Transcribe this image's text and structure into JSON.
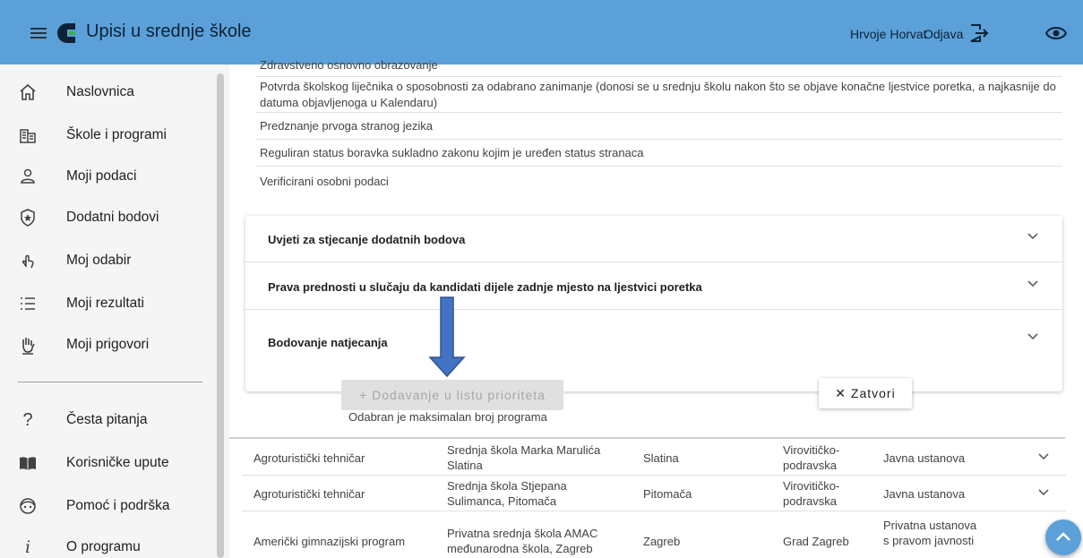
{
  "header": {
    "app_title": "Upisi u srednje škole",
    "user_name": "Hrvoje Horvat",
    "logout_label": "Odjava",
    "bar_color": "#5ba0d9"
  },
  "sidebar": {
    "items": [
      {
        "label": "Naslovnica",
        "icon": "home-icon"
      },
      {
        "label": "Škole i programi",
        "icon": "building-icon"
      },
      {
        "label": "Moji podaci",
        "icon": "person-icon"
      },
      {
        "label": "Dodatni bodovi",
        "icon": "star-shield-icon"
      },
      {
        "label": "Moj odabir",
        "icon": "tap-hand-icon"
      },
      {
        "label": "Moji rezultati",
        "icon": "list-icon"
      },
      {
        "label": "Moji prigovori",
        "icon": "raised-hand-icon"
      }
    ],
    "secondary": [
      {
        "label": "Česta pitanja",
        "icon": "question-icon"
      },
      {
        "label": "Korisničke upute",
        "icon": "book-icon"
      },
      {
        "label": "Pomoć i podrška",
        "icon": "support-icon"
      },
      {
        "label": "O programu",
        "icon": "info-icon"
      }
    ]
  },
  "requirements": [
    "Zdravstveno osnovno obrazovanje",
    "Potvrda školskog liječnika o sposobnosti za odabrano zanimanje (donosi se u srednju školu nakon što se objave konačne ljestvice poretka, a najkasnije do datuma objavljenoga u Kalendaru)",
    "Predznanje prvoga stranog jezika",
    "Reguliran status boravka sukladno zakonu kojim je uređen status stranaca",
    "Verificirani osobni podaci"
  ],
  "accordion": [
    {
      "label": "Uvjeti za stjecanje dodatnih bodova"
    },
    {
      "label": "Prava prednosti u slučaju da kandidati dijele zadnje mjesto na ljestvici poretka"
    },
    {
      "label": "Bodovanje natjecanja"
    }
  ],
  "actions": {
    "add_label": "+ Dodavanje u listu prioriteta",
    "max_message": "Odabran je maksimalan broj programa",
    "close_label": "✕ Zatvori"
  },
  "table": {
    "rows": [
      {
        "program": "Agroturistički tehničar",
        "school": "Srednja škola Marka Marulića Slatina",
        "city": "Slatina",
        "county": "Virovitičko-podravska",
        "type": "Javna ustanova"
      },
      {
        "program": "Agroturistički tehničar",
        "school": "Srednja škola Stjepana Sulimanca, Pitomača",
        "city": "Pitomača",
        "county": "Virovitičko-podravska",
        "type": "Javna ustanova"
      },
      {
        "program": "Američki gimnazijski program",
        "school": "Privatna srednja škola AMAC međunarodna škola, Zagreb",
        "city": "Zagreb",
        "county": "Grad Zagreb",
        "type": "Privatna ustanova s pravom javnosti"
      }
    ]
  }
}
